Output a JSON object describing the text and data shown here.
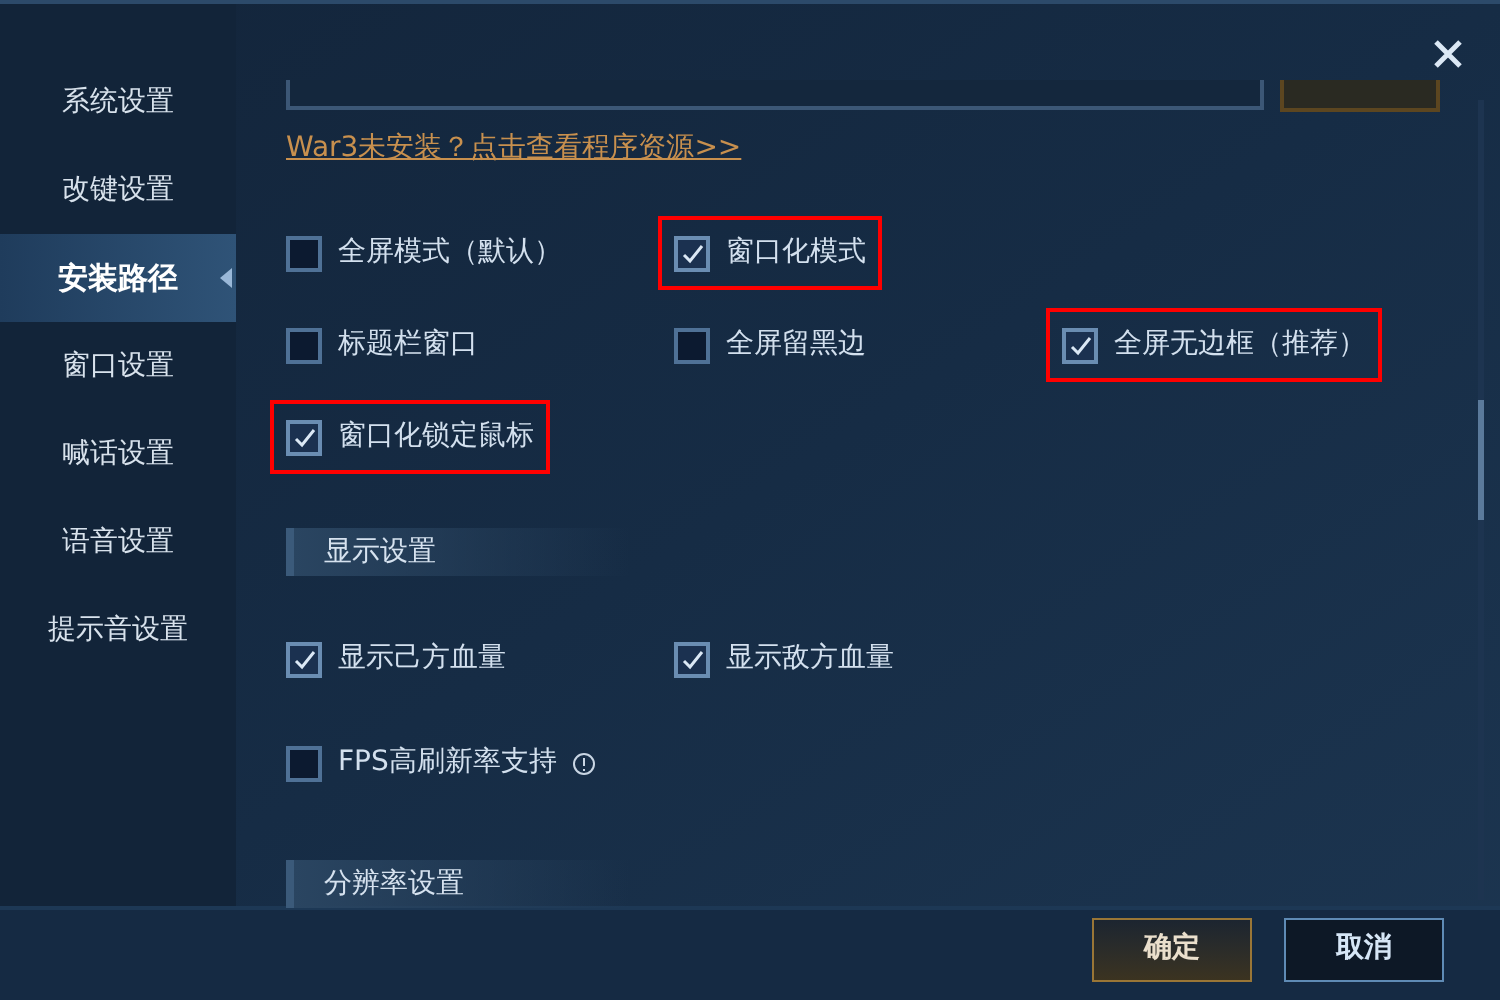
{
  "sidebar": {
    "items": [
      {
        "label": "系统设置",
        "selected": false
      },
      {
        "label": "改键设置",
        "selected": false
      },
      {
        "label": "安装路径",
        "selected": true
      },
      {
        "label": "窗口设置",
        "selected": false
      },
      {
        "label": "喊话设置",
        "selected": false
      },
      {
        "label": "语音设置",
        "selected": false
      },
      {
        "label": "提示音设置",
        "selected": false
      }
    ]
  },
  "install_link": "War3未安装？点击查看程序资源>>",
  "window_option_rows": [
    {
      "options": [
        {
          "label": "全屏模式（默认）",
          "checked": false,
          "highlighted": false
        },
        {
          "label": "窗口化模式",
          "checked": true,
          "highlighted": true
        }
      ]
    },
    {
      "options": [
        {
          "label": "标题栏窗口",
          "checked": false,
          "highlighted": false
        },
        {
          "label": "全屏留黑边",
          "checked": false,
          "highlighted": false
        },
        {
          "label": "全屏无边框（推荐）",
          "checked": true,
          "highlighted": true
        }
      ]
    },
    {
      "options": [
        {
          "label": "窗口化锁定鼠标",
          "checked": true,
          "highlighted": true
        }
      ]
    }
  ],
  "display_section": {
    "title": "显示设置",
    "options": [
      {
        "label": "显示己方血量",
        "checked": true,
        "info": false
      },
      {
        "label": "显示敌方血量",
        "checked": true,
        "info": false
      },
      {
        "label": "FPS高刷新率支持",
        "checked": false,
        "info": true
      }
    ]
  },
  "resolution_section": {
    "title": "分辨率设置"
  },
  "buttons": [
    {
      "label": "确定",
      "kind": "primary"
    },
    {
      "label": "取消",
      "kind": "secondary"
    }
  ]
}
